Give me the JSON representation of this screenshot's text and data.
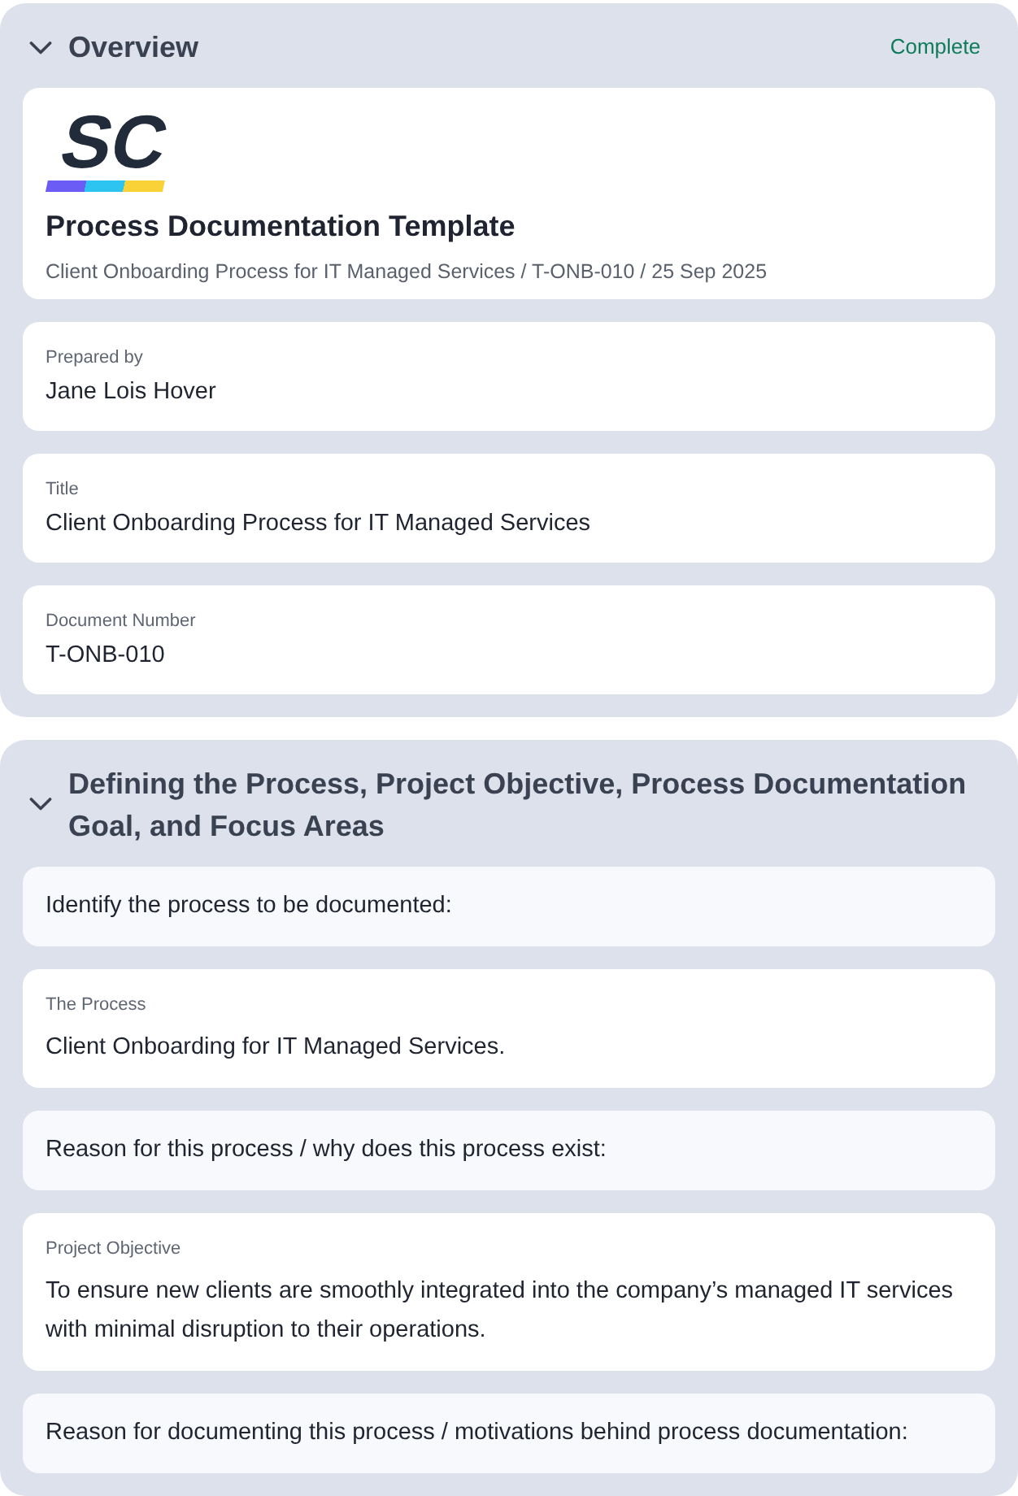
{
  "sections": [
    {
      "title": "Overview",
      "expanded": true,
      "status": "Complete",
      "items": [
        {
          "kind": "header",
          "logo": "SC",
          "title": "Process Documentation Template",
          "subtitle": "Client Onboarding Process for IT Managed Services / T-ONB-010 / 25 Sep 2025"
        },
        {
          "kind": "field",
          "label": "Prepared by",
          "value": "Jane Lois Hover"
        },
        {
          "kind": "field",
          "label": "Title",
          "value": "Client Onboarding Process for IT Managed Services"
        },
        {
          "kind": "field",
          "label": "Document Number",
          "value": "T-ONB-010"
        }
      ]
    },
    {
      "title": "Defining the Process, Project Objective, Process Documentation Goal, and Focus Areas",
      "expanded": true,
      "items": [
        {
          "kind": "prompt",
          "text": "Identify the process to be documented:"
        },
        {
          "kind": "answer",
          "label": "The Process",
          "value": "Client Onboarding for IT Managed Services."
        },
        {
          "kind": "prompt",
          "text": "Reason for this process / why does this process exist:"
        },
        {
          "kind": "answer",
          "label": "Project Objective",
          "value": "To ensure new clients are smoothly integrated into the company’s managed IT services with minimal disruption to their operations."
        },
        {
          "kind": "prompt",
          "text": "Reason for documenting this process / motivations behind process documentation:"
        }
      ]
    }
  ]
}
